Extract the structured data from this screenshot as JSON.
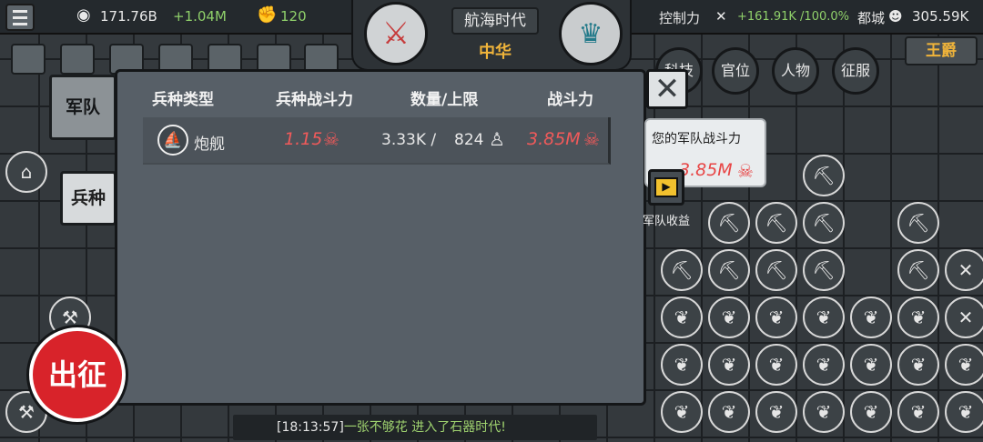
{
  "topbar": {
    "gold": "171.76B",
    "gold_rate": "+1.04M",
    "strength": "120",
    "control_label": "控制力",
    "control_value": "+161.91K /100.0%",
    "capital_label": "都城",
    "population": "305.59K",
    "era": "航海时代",
    "nation": "中华",
    "rank": "王爵"
  },
  "round_menu": [
    "科技",
    "官位",
    "人物",
    "征服"
  ],
  "side_tabs": {
    "army": "军队",
    "unit_type": "兵种"
  },
  "panel": {
    "headers": [
      "兵种类型",
      "兵种战斗力",
      "数量/上限",
      "战斗力"
    ],
    "rows": [
      {
        "unit": "炮舰",
        "unit_power": "1.15",
        "count": "3.33K /",
        "limit": "824",
        "total_power": "3.85M"
      }
    ]
  },
  "tooltip": {
    "label": "您的军队战斗力",
    "value": "3.85M"
  },
  "income_label": "军队收益",
  "march_label": "出征",
  "log": {
    "time": "[18:13:57]",
    "message": "一张不够花 进入了石器时代!"
  },
  "colors": {
    "accent_gold": "#f0b43a",
    "red_power": "#f05a5a",
    "green_stat": "#8fd06a"
  }
}
